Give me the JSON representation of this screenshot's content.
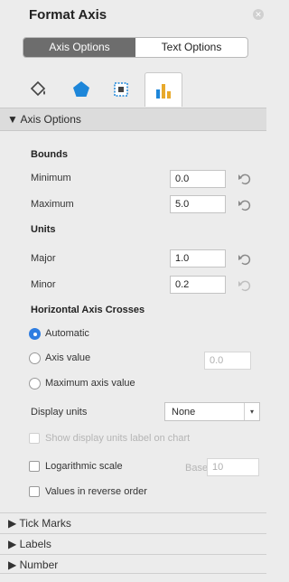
{
  "panel": {
    "title": "Format Axis"
  },
  "tabs": [
    {
      "label": "Axis Options"
    },
    {
      "label": "Text Options"
    }
  ],
  "icon_tabs": [
    "fill-bucket-icon",
    "pentagon-shape-icon",
    "size-properties-icon",
    "bar-chart-icon"
  ],
  "section": {
    "label": "▼ Axis Options"
  },
  "bounds": {
    "heading": "Bounds",
    "minimum": {
      "label": "Minimum",
      "value": "0.0"
    },
    "maximum": {
      "label": "Maximum",
      "value": "5.0"
    }
  },
  "units": {
    "heading": "Units",
    "major": {
      "label": "Major",
      "value": "1.0"
    },
    "minor": {
      "label": "Minor",
      "value": "0.2"
    }
  },
  "crosses": {
    "heading": "Horizontal Axis Crosses",
    "automatic": "Automatic",
    "axis_value": "Axis value",
    "axis_value_placeholder": "0.0",
    "maximum": "Maximum axis value",
    "selected": "Automatic"
  },
  "display_units": {
    "label": "Display units",
    "value": "None"
  },
  "show_label": {
    "label": "Show display units label on chart"
  },
  "log_scale": {
    "label": "Logarithmic scale",
    "base_label": "Base",
    "base_value": "10"
  },
  "reverse": {
    "label": "Values in reverse order"
  },
  "collapsed": [
    {
      "label": "▶ Tick Marks"
    },
    {
      "label": "▶ Labels"
    },
    {
      "label": "▶ Number"
    }
  ],
  "colors": {
    "accent": "#2f7de1",
    "tab_selected": "#6d6d6d"
  }
}
